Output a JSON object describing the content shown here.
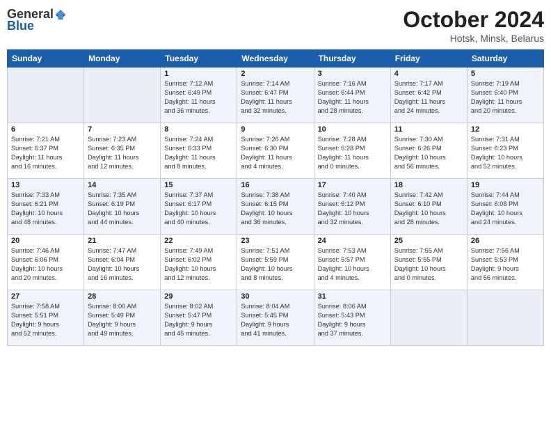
{
  "logo": {
    "general": "General",
    "blue": "Blue"
  },
  "title": "October 2024",
  "subtitle": "Hotsk, Minsk, Belarus",
  "days_of_week": [
    "Sunday",
    "Monday",
    "Tuesday",
    "Wednesday",
    "Thursday",
    "Friday",
    "Saturday"
  ],
  "weeks": [
    [
      {
        "day": "",
        "info": ""
      },
      {
        "day": "",
        "info": ""
      },
      {
        "day": "1",
        "info": "Sunrise: 7:12 AM\nSunset: 6:49 PM\nDaylight: 11 hours\nand 36 minutes."
      },
      {
        "day": "2",
        "info": "Sunrise: 7:14 AM\nSunset: 6:47 PM\nDaylight: 11 hours\nand 32 minutes."
      },
      {
        "day": "3",
        "info": "Sunrise: 7:16 AM\nSunset: 6:44 PM\nDaylight: 11 hours\nand 28 minutes."
      },
      {
        "day": "4",
        "info": "Sunrise: 7:17 AM\nSunset: 6:42 PM\nDaylight: 11 hours\nand 24 minutes."
      },
      {
        "day": "5",
        "info": "Sunrise: 7:19 AM\nSunset: 6:40 PM\nDaylight: 11 hours\nand 20 minutes."
      }
    ],
    [
      {
        "day": "6",
        "info": "Sunrise: 7:21 AM\nSunset: 6:37 PM\nDaylight: 11 hours\nand 16 minutes."
      },
      {
        "day": "7",
        "info": "Sunrise: 7:23 AM\nSunset: 6:35 PM\nDaylight: 11 hours\nand 12 minutes."
      },
      {
        "day": "8",
        "info": "Sunrise: 7:24 AM\nSunset: 6:33 PM\nDaylight: 11 hours\nand 8 minutes."
      },
      {
        "day": "9",
        "info": "Sunrise: 7:26 AM\nSunset: 6:30 PM\nDaylight: 11 hours\nand 4 minutes."
      },
      {
        "day": "10",
        "info": "Sunrise: 7:28 AM\nSunset: 6:28 PM\nDaylight: 11 hours\nand 0 minutes."
      },
      {
        "day": "11",
        "info": "Sunrise: 7:30 AM\nSunset: 6:26 PM\nDaylight: 10 hours\nand 56 minutes."
      },
      {
        "day": "12",
        "info": "Sunrise: 7:31 AM\nSunset: 6:23 PM\nDaylight: 10 hours\nand 52 minutes."
      }
    ],
    [
      {
        "day": "13",
        "info": "Sunrise: 7:33 AM\nSunset: 6:21 PM\nDaylight: 10 hours\nand 48 minutes."
      },
      {
        "day": "14",
        "info": "Sunrise: 7:35 AM\nSunset: 6:19 PM\nDaylight: 10 hours\nand 44 minutes."
      },
      {
        "day": "15",
        "info": "Sunrise: 7:37 AM\nSunset: 6:17 PM\nDaylight: 10 hours\nand 40 minutes."
      },
      {
        "day": "16",
        "info": "Sunrise: 7:38 AM\nSunset: 6:15 PM\nDaylight: 10 hours\nand 36 minutes."
      },
      {
        "day": "17",
        "info": "Sunrise: 7:40 AM\nSunset: 6:12 PM\nDaylight: 10 hours\nand 32 minutes."
      },
      {
        "day": "18",
        "info": "Sunrise: 7:42 AM\nSunset: 6:10 PM\nDaylight: 10 hours\nand 28 minutes."
      },
      {
        "day": "19",
        "info": "Sunrise: 7:44 AM\nSunset: 6:08 PM\nDaylight: 10 hours\nand 24 minutes."
      }
    ],
    [
      {
        "day": "20",
        "info": "Sunrise: 7:46 AM\nSunset: 6:06 PM\nDaylight: 10 hours\nand 20 minutes."
      },
      {
        "day": "21",
        "info": "Sunrise: 7:47 AM\nSunset: 6:04 PM\nDaylight: 10 hours\nand 16 minutes."
      },
      {
        "day": "22",
        "info": "Sunrise: 7:49 AM\nSunset: 6:02 PM\nDaylight: 10 hours\nand 12 minutes."
      },
      {
        "day": "23",
        "info": "Sunrise: 7:51 AM\nSunset: 5:59 PM\nDaylight: 10 hours\nand 8 minutes."
      },
      {
        "day": "24",
        "info": "Sunrise: 7:53 AM\nSunset: 5:57 PM\nDaylight: 10 hours\nand 4 minutes."
      },
      {
        "day": "25",
        "info": "Sunrise: 7:55 AM\nSunset: 5:55 PM\nDaylight: 10 hours\nand 0 minutes."
      },
      {
        "day": "26",
        "info": "Sunrise: 7:56 AM\nSunset: 5:53 PM\nDaylight: 9 hours\nand 56 minutes."
      }
    ],
    [
      {
        "day": "27",
        "info": "Sunrise: 7:58 AM\nSunset: 5:51 PM\nDaylight: 9 hours\nand 52 minutes."
      },
      {
        "day": "28",
        "info": "Sunrise: 8:00 AM\nSunset: 5:49 PM\nDaylight: 9 hours\nand 49 minutes."
      },
      {
        "day": "29",
        "info": "Sunrise: 8:02 AM\nSunset: 5:47 PM\nDaylight: 9 hours\nand 45 minutes."
      },
      {
        "day": "30",
        "info": "Sunrise: 8:04 AM\nSunset: 5:45 PM\nDaylight: 9 hours\nand 41 minutes."
      },
      {
        "day": "31",
        "info": "Sunrise: 8:06 AM\nSunset: 5:43 PM\nDaylight: 9 hours\nand 37 minutes."
      },
      {
        "day": "",
        "info": ""
      },
      {
        "day": "",
        "info": ""
      }
    ]
  ]
}
